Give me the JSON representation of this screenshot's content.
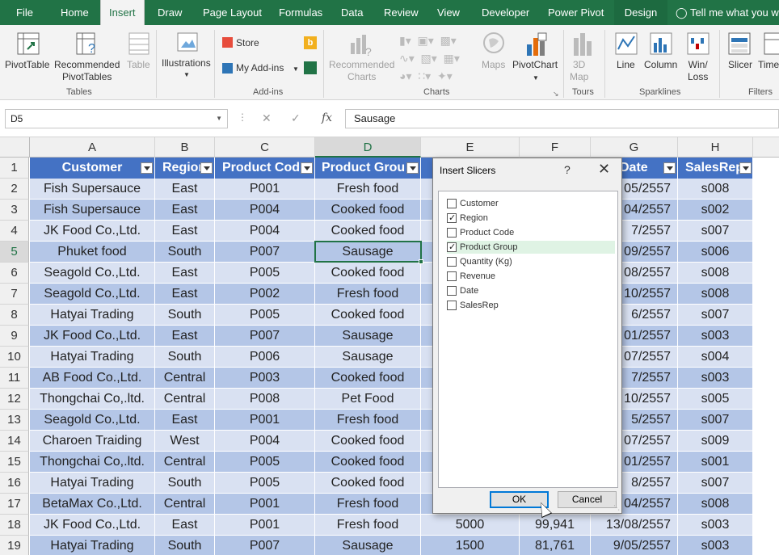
{
  "ribbon_tabs": [
    "File",
    "Home",
    "Insert",
    "Draw",
    "Page Layout",
    "Formulas",
    "Data",
    "Review",
    "View",
    "Developer",
    "Power Pivot",
    "Design"
  ],
  "tell_me": "Tell me what you wa",
  "ribbon": {
    "pivottable": "PivotTable",
    "recommended_pivot_1": "Recommended",
    "recommended_pivot_2": "PivotTables",
    "table": "Table",
    "illustrations": "Illustrations",
    "store": "Store",
    "my_addins": "My Add-ins",
    "rec_charts_1": "Recommended",
    "rec_charts_2": "Charts",
    "maps": "Maps",
    "pivotchart": "PivotChart",
    "map3d_1": "3D",
    "map3d_2": "Map",
    "line": "Line",
    "column": "Column",
    "winloss_1": "Win/",
    "winloss_2": "Loss",
    "slicer": "Slicer",
    "timeline": "Time",
    "groups": {
      "tables": "Tables",
      "addins": "Add-ins",
      "charts": "Charts",
      "tours": "Tours",
      "sparklines": "Sparklines",
      "filters": "Filters"
    }
  },
  "formula_bar": {
    "name_box": "D5",
    "formula": "Sausage"
  },
  "columns": [
    "A",
    "B",
    "C",
    "D",
    "E",
    "F",
    "G",
    "H"
  ],
  "headers": [
    "Customer",
    "Region",
    "Product Cod",
    "Product Grou",
    "",
    "",
    "Date",
    "SalesRep"
  ],
  "rows": [
    {
      "n": "1"
    },
    {
      "n": "2",
      "a": "Fish Supersauce",
      "b": "East",
      "c": "P001",
      "d": "Fresh food",
      "g": "05/2557",
      "h": "s008"
    },
    {
      "n": "3",
      "a": "Fish Supersauce",
      "b": "East",
      "c": "P004",
      "d": "Cooked food",
      "g": "04/2557",
      "h": "s002"
    },
    {
      "n": "4",
      "a": "JK Food Co.,Ltd.",
      "b": "East",
      "c": "P004",
      "d": "Cooked food",
      "g": "7/2557",
      "h": "s007"
    },
    {
      "n": "5",
      "a": "Phuket food",
      "b": "South",
      "c": "P007",
      "d": "Sausage",
      "g": "09/2557",
      "h": "s006"
    },
    {
      "n": "6",
      "a": "Seagold Co.,Ltd.",
      "b": "East",
      "c": "P005",
      "d": "Cooked food",
      "g": "08/2557",
      "h": "s008"
    },
    {
      "n": "7",
      "a": "Seagold Co.,Ltd.",
      "b": "East",
      "c": "P002",
      "d": "Fresh food",
      "g": "10/2557",
      "h": "s008"
    },
    {
      "n": "8",
      "a": "Hatyai Trading",
      "b": "South",
      "c": "P005",
      "d": "Cooked food",
      "g": "6/2557",
      "h": "s007"
    },
    {
      "n": "9",
      "a": "JK Food Co.,Ltd.",
      "b": "East",
      "c": "P007",
      "d": "Sausage",
      "g": "01/2557",
      "h": "s003"
    },
    {
      "n": "10",
      "a": "Hatyai Trading",
      "b": "South",
      "c": "P006",
      "d": "Sausage",
      "g": "07/2557",
      "h": "s004"
    },
    {
      "n": "11",
      "a": "AB Food Co.,Ltd.",
      "b": "Central",
      "c": "P003",
      "d": "Cooked food",
      "g": "7/2557",
      "h": "s003"
    },
    {
      "n": "12",
      "a": "Thongchai Co,.ltd.",
      "b": "Central",
      "c": "P008",
      "d": "Pet Food",
      "g": "10/2557",
      "h": "s005"
    },
    {
      "n": "13",
      "a": "Seagold Co.,Ltd.",
      "b": "East",
      "c": "P001",
      "d": "Fresh food",
      "g": "5/2557",
      "h": "s007"
    },
    {
      "n": "14",
      "a": "Charoen Traiding",
      "b": "West",
      "c": "P004",
      "d": "Cooked food",
      "g": "07/2557",
      "h": "s009"
    },
    {
      "n": "15",
      "a": "Thongchai Co,.ltd.",
      "b": "Central",
      "c": "P005",
      "d": "Cooked food",
      "g": "01/2557",
      "h": "s001"
    },
    {
      "n": "16",
      "a": "Hatyai Trading",
      "b": "South",
      "c": "P005",
      "d": "Cooked food",
      "g": "8/2557",
      "h": "s007"
    },
    {
      "n": "17",
      "a": "BetaMax Co.,Ltd.",
      "b": "Central",
      "c": "P001",
      "d": "Fresh food",
      "g": "04/2557",
      "h": "s008"
    },
    {
      "n": "18",
      "a": "JK Food Co.,Ltd.",
      "b": "East",
      "c": "P001",
      "d": "Fresh food",
      "e": "5000",
      "f": "99,941",
      "g": "13/08/2557",
      "h": "s003"
    },
    {
      "n": "19",
      "a": "Hatyai Trading",
      "b": "South",
      "c": "P007",
      "d": "Sausage",
      "e": "1500",
      "f": "81,761",
      "g": "9/05/2557",
      "h": "s003"
    }
  ],
  "dialog": {
    "title": "Insert Slicers",
    "help": "?",
    "close": "✕",
    "items": [
      {
        "label": "Customer",
        "checked": false
      },
      {
        "label": "Region",
        "checked": true
      },
      {
        "label": "Product Code",
        "checked": false
      },
      {
        "label": "Product Group",
        "checked": true
      },
      {
        "label": "Quantity (Kg)",
        "checked": false
      },
      {
        "label": "Revenue",
        "checked": false
      },
      {
        "label": "Date",
        "checked": false
      },
      {
        "label": "SalesRep",
        "checked": false
      }
    ],
    "ok": "OK",
    "cancel": "Cancel"
  },
  "colors": {
    "excel_green": "#217346",
    "table_header": "#4472c4",
    "band_dark": "#b4c6e7",
    "band_light": "#d9e1f2"
  }
}
